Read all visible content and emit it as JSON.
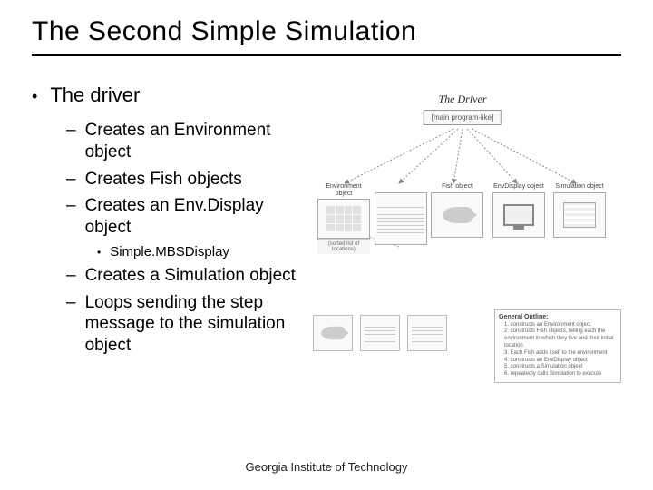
{
  "title": "The Second Simple Simulation",
  "footer": "Georgia Institute of Technology",
  "bullets": {
    "l1": "The driver",
    "l2_1": "Creates an Environment object",
    "l2_2": "Creates Fish objects",
    "l2_3": "Creates an Env.Display object",
    "l3_1": "Simple.MBSDisplay",
    "l2_4": "Creates a Simulation object",
    "l2_5": "Loops sending the step message to the simulation object"
  },
  "diagram": {
    "driver_title": "The Driver",
    "driver_text": "[main program-like]",
    "env_label": "Environment object",
    "env_sub": "(sorted list of locations)",
    "fish_label": "Fish object",
    "envdisplay_label": "EnvDisplay object",
    "sim_label": "Simulation object",
    "outline_title": "General Outline:",
    "outline_1": "1. constructs an Environment object",
    "outline_2": "2. constructs Fish objects, telling each the environment in which they live and their initial location",
    "outline_3": "3. Each Fish adds itself to the environment",
    "outline_4": "4. constructs an EnvDisplay object",
    "outline_5": "5. constructs a Simulation object",
    "outline_6": "6. repeatedly calls Simulation to execute"
  }
}
